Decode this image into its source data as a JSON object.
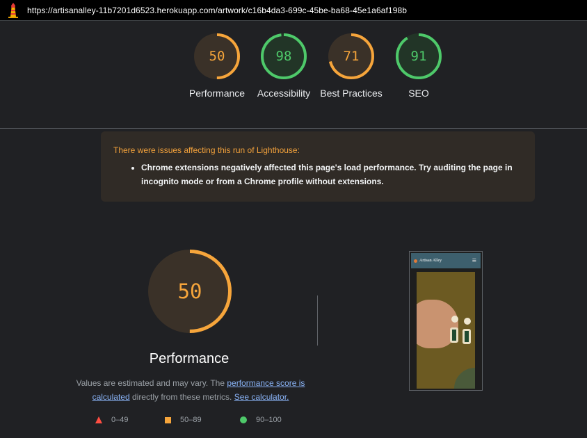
{
  "address_bar": {
    "url": "https://artisanalley-11b7201d6523.herokuapp.com/artwork/c16b4da3-699c-45be-ba68-45e1a6af198b",
    "logo_icon": "lighthouse-icon"
  },
  "scores": [
    {
      "label": "Performance",
      "value": "50",
      "color": "#f6a53b",
      "track": "#3a3128",
      "fraction": 0.5
    },
    {
      "label": "Accessibility",
      "value": "98",
      "color": "#4ec96a",
      "track": "#223527",
      "fraction": 0.98
    },
    {
      "label": "Best Practices",
      "value": "71",
      "color": "#f6a53b",
      "track": "#3a3128",
      "fraction": 0.71
    },
    {
      "label": "SEO",
      "value": "91",
      "color": "#4ec96a",
      "track": "#223527",
      "fraction": 0.91
    }
  ],
  "warning": {
    "title": "There were issues affecting this run of Lighthouse:",
    "items": [
      "Chrome extensions negatively affected this page's load performance. Try auditing the page in incognito mode or from a Chrome profile without extensions."
    ]
  },
  "performance": {
    "score": "50",
    "fraction": 0.5,
    "title": "Performance",
    "desc_prefix": "Values are estimated and may vary. The ",
    "link_score": "performance score is calculated",
    "desc_middle": " directly from these metrics. ",
    "link_calc": "See calculator."
  },
  "legend": {
    "fail": "0–49",
    "average": "50–89",
    "pass": "90–100"
  },
  "screenshot_thumb": {
    "brand": "Artisan Alley",
    "menu_icon": "hamburger-menu-icon"
  }
}
